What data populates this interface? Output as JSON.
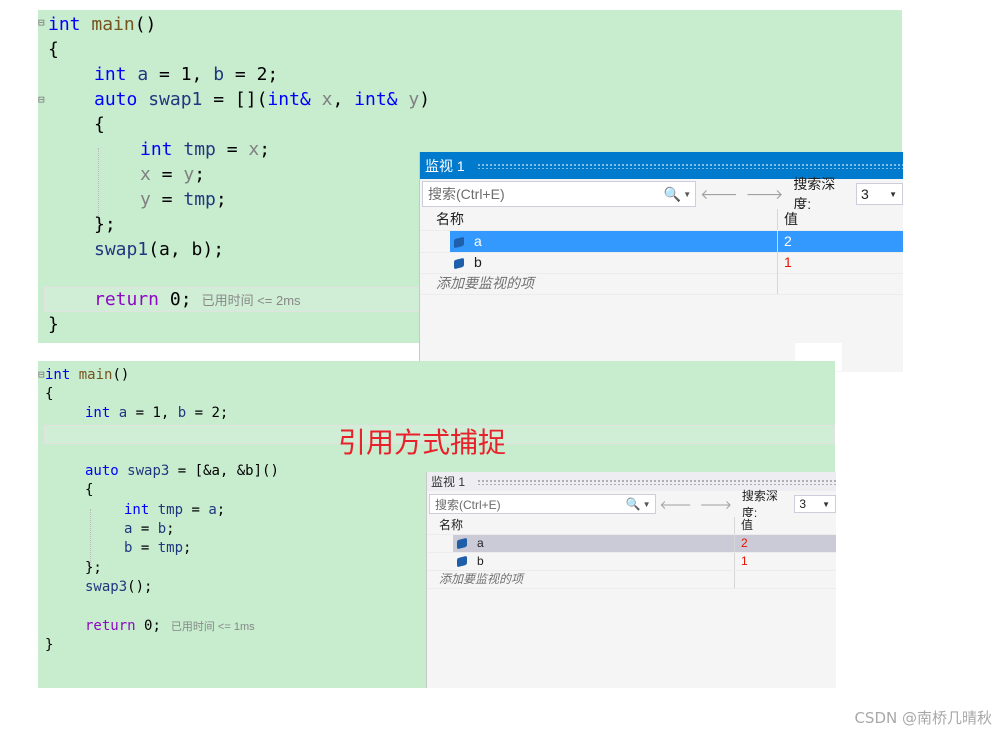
{
  "top_code": {
    "l1": {
      "kw": "int",
      "fn": "main",
      "rest": "()"
    },
    "l2": "{",
    "l3": {
      "kw": "int",
      "a": "a",
      "eq1": " = 1, ",
      "b": "b",
      "eq2": " = 2;"
    },
    "l4": {
      "kw": "auto",
      "var": "swap1",
      "mid": " = [](",
      "t1": "int&",
      "p1": "x",
      "sep": ", ",
      "t2": "int&",
      "p2": "y",
      "end": ")"
    },
    "l5": "{",
    "l6": {
      "kw": "int",
      "var": "tmp",
      "eq": " = ",
      "par": "x",
      "end": ";"
    },
    "l7": {
      "par": "x",
      "eq": " = ",
      "par2": "y",
      "end": ";"
    },
    "l8": {
      "par": "y",
      "eq": " = ",
      "var": "tmp",
      "end": ";"
    },
    "l9": "};",
    "l10": {
      "var": "swap1",
      "args": "(a, b);"
    },
    "l11": {
      "kw": "return",
      "rest": "0;",
      "elapsed": "已用时间 <= 2ms"
    },
    "l12": "}"
  },
  "bottom_code": {
    "l1": {
      "kw": "int",
      "fn": "main",
      "rest": "()"
    },
    "l2": "{",
    "l3": {
      "kw": "int",
      "a": "a",
      "eq1": " = 1, ",
      "b": "b",
      "eq2": " = 2;"
    },
    "l4": {
      "kw": "auto",
      "var": "swap3",
      "rest": " = [&a, &b]()"
    },
    "l5": "{",
    "l6": {
      "kw": "int",
      "var": "tmp",
      "eq": " = ",
      "a": "a",
      "end": ";"
    },
    "l7": {
      "a": "a",
      "eq": " = ",
      "b": "b",
      "end": ";"
    },
    "l8": {
      "b": "b",
      "eq": " = ",
      "var": "tmp",
      "end": ";"
    },
    "l9": "};",
    "l10": {
      "var": "swap3",
      "args": "();"
    },
    "l11": {
      "kw": "return",
      "rest": "0;",
      "elapsed": "已用时间 <= 1ms"
    },
    "l12": "}"
  },
  "watch_top": {
    "title": "监视 1",
    "search_placeholder": "搜索(Ctrl+E)",
    "search_icon": "🔍",
    "caret": "▼",
    "back_arrow": "🡐",
    "forward_arrow": "🡒",
    "depth_label": "搜索深度:",
    "depth_value": "3",
    "col_name": "名称",
    "col_value": "值",
    "rows": [
      {
        "name": "a",
        "value": "2"
      },
      {
        "name": "b",
        "value": "1"
      }
    ],
    "add_item": "添加要监视的项"
  },
  "watch_bottom": {
    "title": "监视 1",
    "search_placeholder": "搜索(Ctrl+E)",
    "search_icon": "🔍",
    "caret": "▼",
    "back_arrow": "🡐",
    "forward_arrow": "🡒",
    "depth_label": "搜索深度:",
    "depth_value": "3",
    "col_name": "名称",
    "col_value": "值",
    "rows": [
      {
        "name": "a",
        "value": "2"
      },
      {
        "name": "b",
        "value": "1"
      }
    ],
    "add_item": "添加要监视的项"
  },
  "caption": "引用方式捕捉",
  "watermark": "CSDN @南桥几晴秋",
  "colors": {
    "editor_bg": "#c7ecce",
    "watch_title_active": "#007acc",
    "selected_row": "#3399ff",
    "value_red": "#e51400",
    "caption_red": "#e8222a"
  }
}
